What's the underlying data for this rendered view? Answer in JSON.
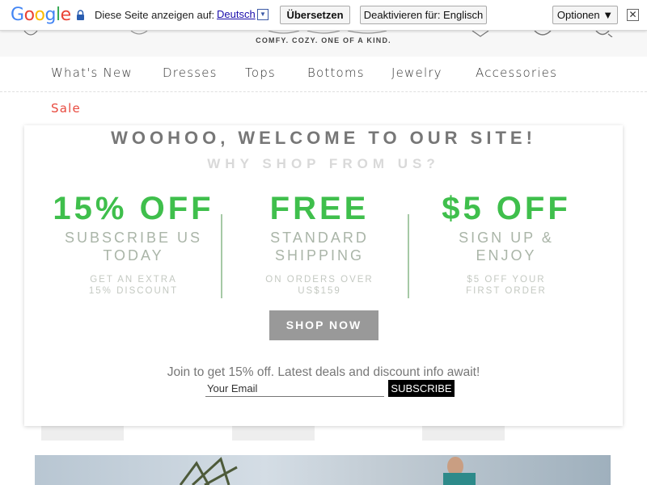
{
  "translate_bar": {
    "logo": [
      "G",
      "o",
      "o",
      "g",
      "l",
      "e"
    ],
    "logo_colors": [
      "#4285F4",
      "#EA4335",
      "#FBBC05",
      "#4285F4",
      "#34A853",
      "#EA4335"
    ],
    "prompt": "Diese Seite anzeigen auf:",
    "language": "Deutsch",
    "translate_button": "Übersetzen",
    "deactivate_button": "Deaktivieren für: Englisch",
    "options_button": "Optionen ▼",
    "close_glyph": "✕"
  },
  "header": {
    "tagline": "COMFY. COZY. ONE OF A KIND."
  },
  "nav": {
    "items": [
      "What's New",
      "Dresses",
      "Tops",
      "Bottoms",
      "Jewelry",
      "Accessories"
    ],
    "sale": "Sale"
  },
  "popup": {
    "welcome": "WOOHOO, WELCOME TO OUR SITE!",
    "why": "WHY SHOP FROM US?",
    "offers": [
      {
        "big": "15% OFF",
        "sub1": "SUBSCRIBE US",
        "sub2": "TODAY",
        "small1": "GET AN EXTRA",
        "small2": "15% DISCOUNT"
      },
      {
        "big": "FREE",
        "sub1": "STANDARD",
        "sub2": "SHIPPING",
        "small1": "ON ORDERS OVER",
        "small2": "US$159"
      },
      {
        "big": "$5 OFF",
        "sub1": "SIGN UP &",
        "sub2": "ENJOY",
        "small1": "$5 OFF YOUR",
        "small2": "FIRST ORDER"
      }
    ],
    "shop_now": "SHOP NOW",
    "join_text": "Join to get 15% off. Latest deals and discount info await!",
    "email_placeholder": "Your Email",
    "subscribe": "SUBSCRIBE"
  },
  "colors": {
    "offer_green": "#3fbf4c",
    "sale_red": "#e84a3f",
    "shop_now_bg": "#999999"
  }
}
